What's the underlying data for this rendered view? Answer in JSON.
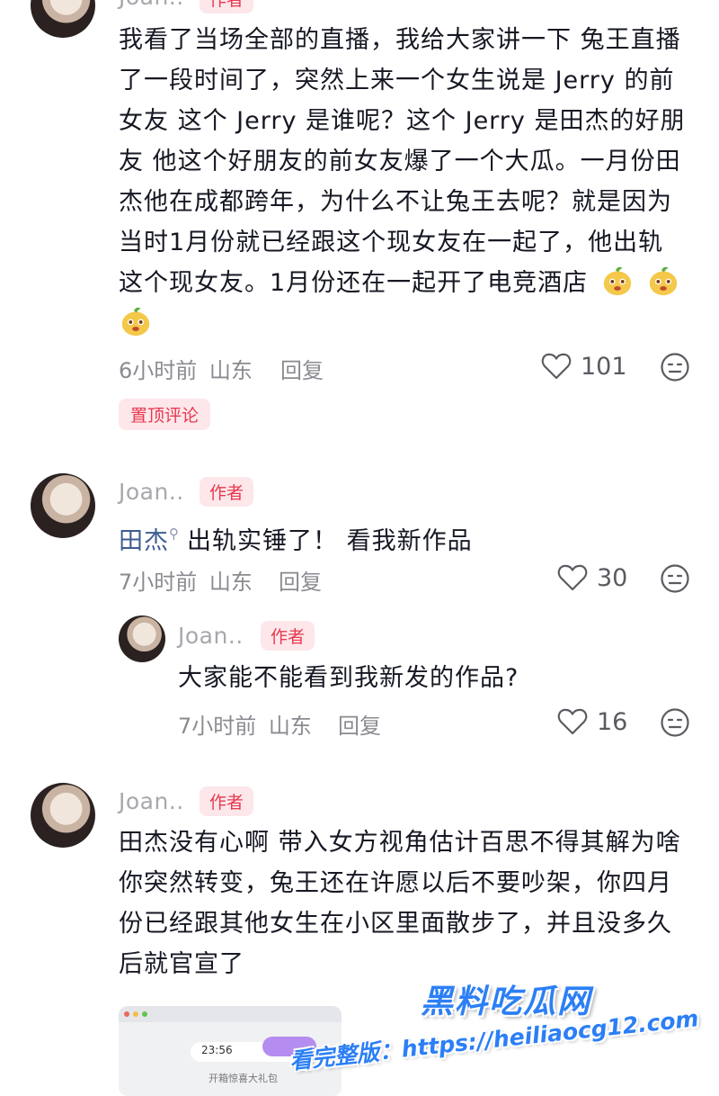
{
  "comments": [
    {
      "username": "Joan..",
      "badge": "作者",
      "lines": [
        "我看了当场全部的直播，我给大家讲一下 兔王直播",
        "了一段时间了，突然上来一个女生说是 Jerry 的前",
        "女友 这个 Jerry 是谁呢？这个 Jerry 是田杰的好朋",
        "友 他这个好朋友的前女友爆了一个大瓜。一月份田",
        "杰他在成都跨年，为什么不让兔王去呢？就是因为",
        "当时1月份就已经跟这个现女友在一起了，他出轨",
        "这个现女友。1月份还在一起开了电竞酒店"
      ],
      "time": "6小时前",
      "location": "山东",
      "reply": "回复",
      "likes": "101",
      "pinned": "置顶评论"
    },
    {
      "username": "Joan..",
      "badge": "作者",
      "mention": "田杰",
      "text": "出轨实锤了！ 看我新作品",
      "time": "7小时前",
      "location": "山东",
      "reply": "回复",
      "likes": "30"
    },
    {
      "username": "Joan..",
      "badge": "作者",
      "text": "大家能不能看到我新发的作品?",
      "time": "7小时前",
      "location": "山东",
      "reply": "回复",
      "likes": "16"
    },
    {
      "username": "Joan..",
      "badge": "作者",
      "lines": [
        "田杰没有心啊 带入女方视角估计百思不得其解为啥",
        "你突然转变，兔王还在许愿以后不要吵架，你四月",
        "份已经跟其他女生在小区里面散步了，并且没多久",
        "后就官宣了"
      ]
    }
  ],
  "thumbnail": {
    "time": "23:56",
    "caption": "开箱惊喜大礼包"
  },
  "watermark": {
    "title": "黑料吃瓜网",
    "url": "看完整版：https://heiliaocg12.com"
  },
  "colors": {
    "accent": "#e8384f",
    "badge_bg": "#fde7ea",
    "mention": "#3e5c90",
    "watermark": "#2c7ff5"
  }
}
